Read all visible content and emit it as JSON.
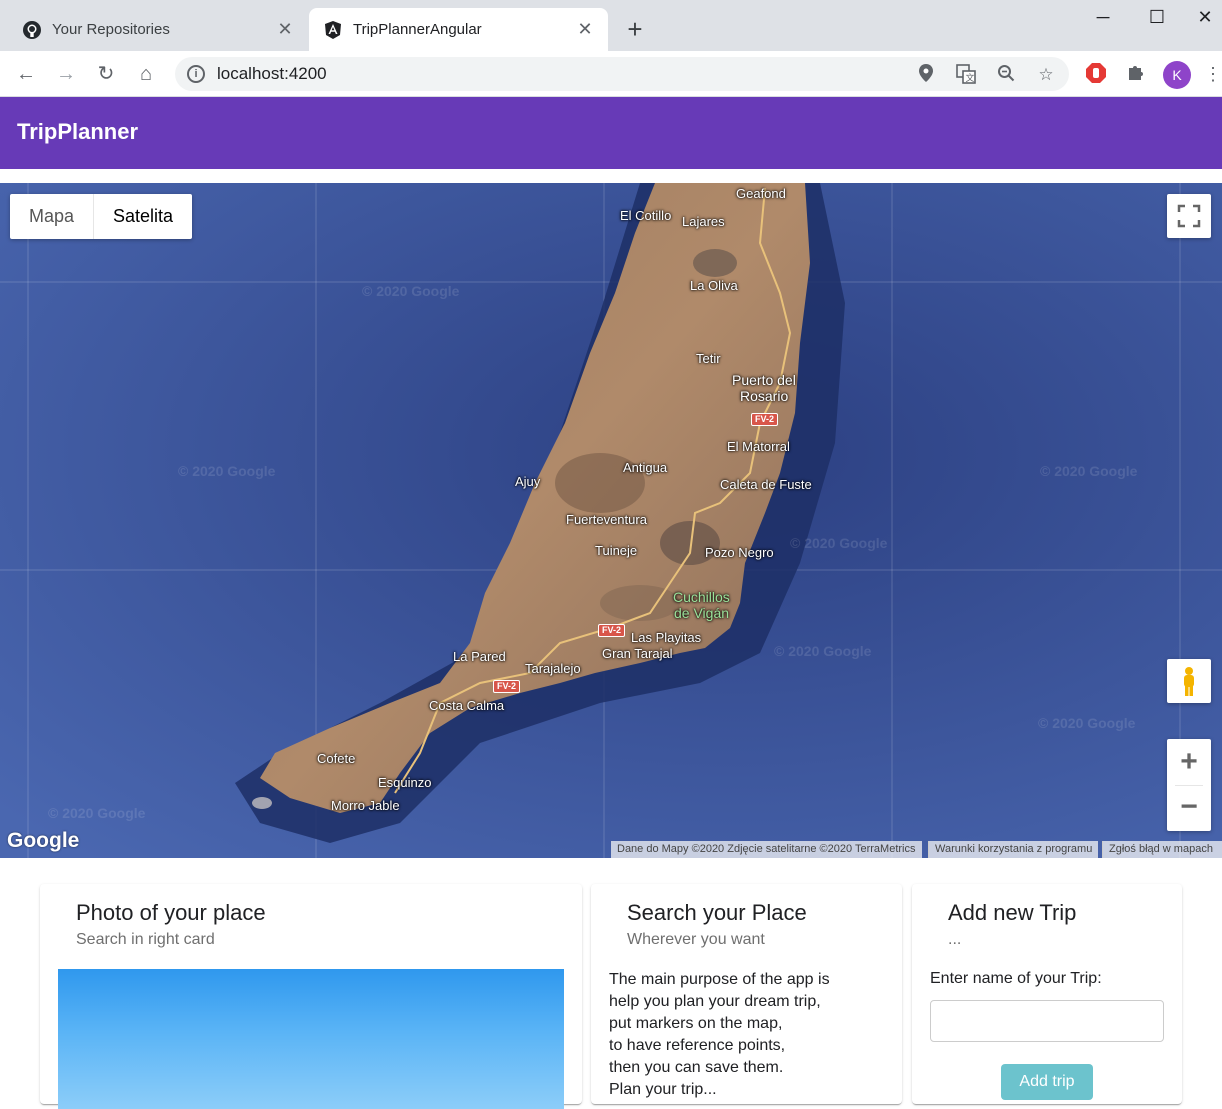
{
  "browser": {
    "tabs": [
      {
        "title": "Your Repositories",
        "icon": "github-icon",
        "active": false
      },
      {
        "title": "TripPlannerAngular",
        "icon": "angular-icon",
        "active": true
      }
    ],
    "url": "localhost:4200",
    "profile_initial": "K"
  },
  "app": {
    "title": "TripPlanner"
  },
  "map": {
    "type_buttons": [
      "Mapa",
      "Satelita"
    ],
    "selected_type": "Satelita",
    "places": [
      {
        "name": "Geafond",
        "green": false
      },
      {
        "name": "El Cotillo",
        "green": false
      },
      {
        "name": "Lajares",
        "green": false
      },
      {
        "name": "La Oliva",
        "green": false
      },
      {
        "name": "Tetir",
        "green": false
      },
      {
        "name": "Puerto del",
        "green": false
      },
      {
        "name": "Rosario",
        "green": false
      },
      {
        "name": "El Matorral",
        "green": false
      },
      {
        "name": "Antigua",
        "green": false
      },
      {
        "name": "Ajuy",
        "green": false
      },
      {
        "name": "Caleta de Fuste",
        "green": false
      },
      {
        "name": "Fuerteventura",
        "green": false
      },
      {
        "name": "Tuineje",
        "green": false
      },
      {
        "name": "Pozo Negro",
        "green": false
      },
      {
        "name": "Cuchillos",
        "green": true
      },
      {
        "name": "de Vigán",
        "green": true
      },
      {
        "name": "Las Playitas",
        "green": false
      },
      {
        "name": "Gran Tarajal",
        "green": false
      },
      {
        "name": "La Pared",
        "green": false
      },
      {
        "name": "Tarajalejo",
        "green": false
      },
      {
        "name": "Costa Calma",
        "green": false
      },
      {
        "name": "Cofete",
        "green": false
      },
      {
        "name": "Esquinzo",
        "green": false
      },
      {
        "name": "Morro Jable",
        "green": false
      }
    ],
    "road_labels": [
      "FV-2",
      "FV-2",
      "FV-2"
    ],
    "watermark": "© 2020 Google",
    "logo": "Google",
    "attribution": [
      "Dane do Mapy ©2020 Zdjęcie satelitarne ©2020 TerraMetrics",
      "Warunki korzystania z programu",
      "Zgłoś błąd w mapach"
    ]
  },
  "cards": {
    "photo": {
      "title": "Photo of your place",
      "subtitle": "Search in right card"
    },
    "search": {
      "title": "Search your Place",
      "subtitle": "Wherever you want",
      "body": [
        "The main purpose of the app is",
        "help you plan your dream trip,",
        "put markers on the map,",
        "to have reference points,",
        "then you can save them.",
        "Plan your trip..."
      ]
    },
    "trip": {
      "title": "Add new Trip",
      "subtitle": "...",
      "input_label": "Enter name of your Trip:",
      "input_value": "",
      "button_label": "Add trip"
    }
  }
}
